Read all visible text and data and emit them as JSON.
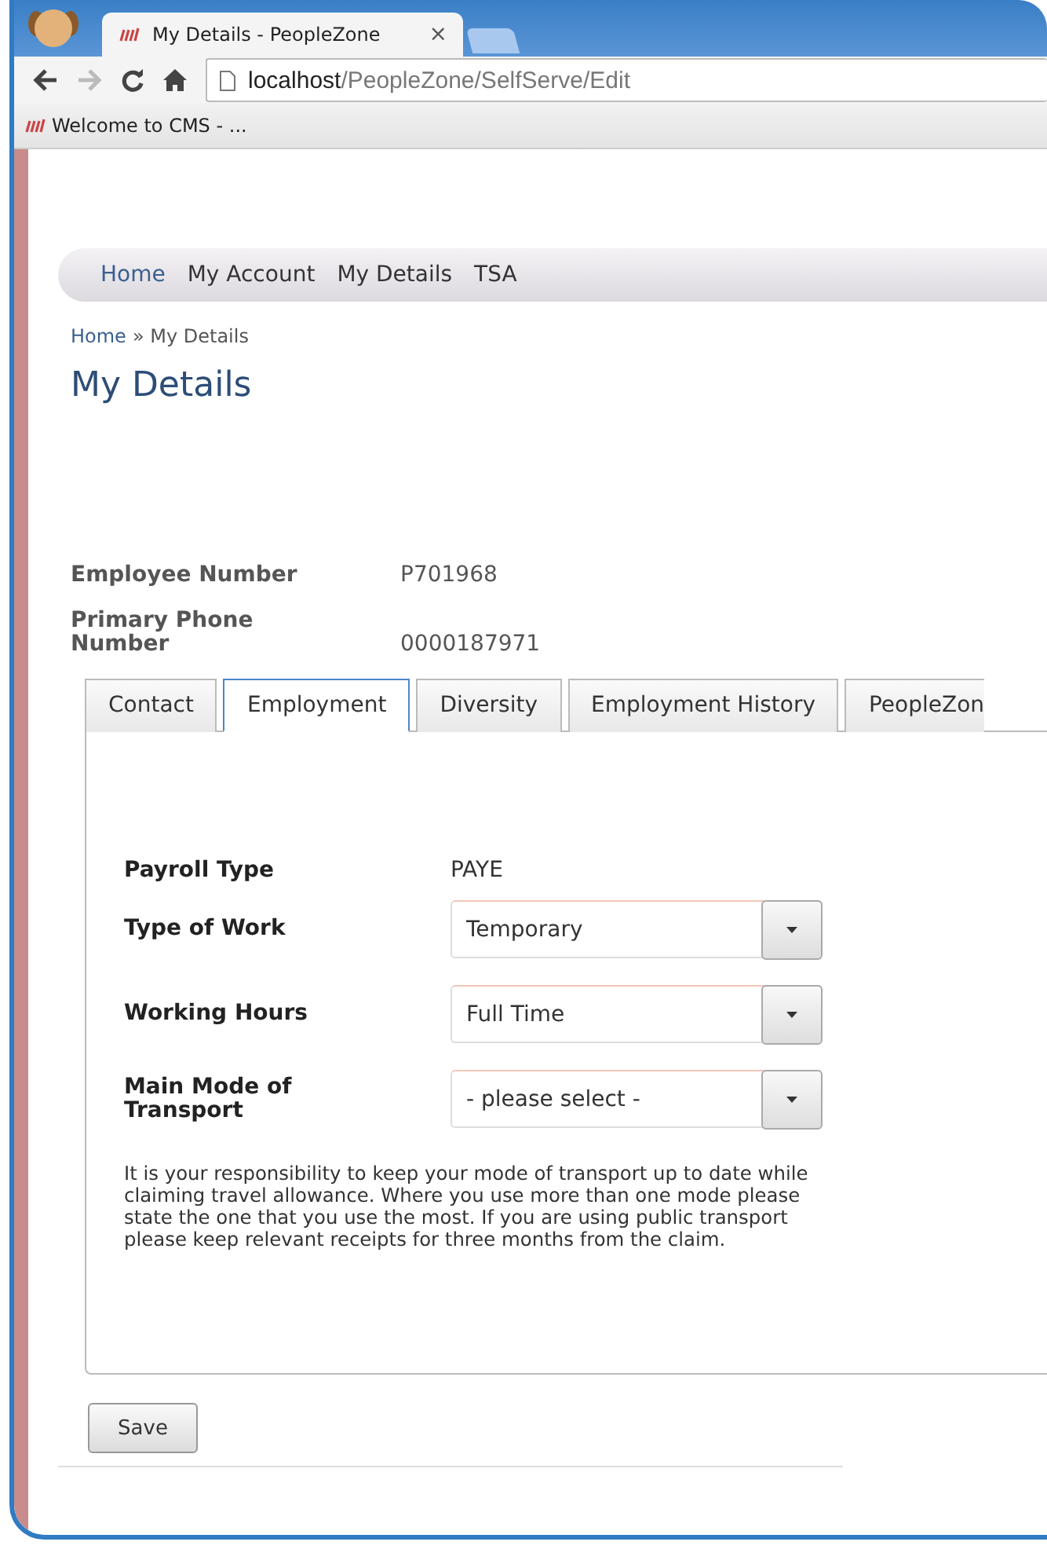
{
  "browser": {
    "tab_title": "My Details - PeopleZone",
    "tab_close": "×",
    "address": {
      "host": "localhost",
      "path": "/PeopleZone/SelfServe/Edit"
    },
    "bookmarks": [
      "Welcome to CMS - ..."
    ]
  },
  "nav": [
    {
      "label": "Home",
      "selected": true
    },
    {
      "label": "My Account",
      "selected": false
    },
    {
      "label": "My Details",
      "selected": false
    },
    {
      "label": "TSA",
      "selected": false
    }
  ],
  "breadcrumb": {
    "link": "Home",
    "separator": "»",
    "current": "My Details"
  },
  "title": "My Details",
  "summary": [
    {
      "label": "Employee Number",
      "value": "P701968"
    },
    {
      "label": "Primary Phone Number",
      "value": "0000187971"
    }
  ],
  "tabs": [
    {
      "label": "Contact",
      "selected": false
    },
    {
      "label": "Employment",
      "selected": true
    },
    {
      "label": "Diversity",
      "selected": false
    },
    {
      "label": "Employment History",
      "selected": false
    },
    {
      "label": "PeopleZon",
      "selected": false
    }
  ],
  "fields": [
    {
      "kind": "text",
      "label": "Payroll Type",
      "value": "PAYE"
    },
    {
      "kind": "select",
      "label": "Type of Work",
      "value": "Temporary"
    },
    {
      "kind": "select",
      "label": "Working Hours",
      "value": "Full Time"
    },
    {
      "kind": "select",
      "label": "Main Mode of Transport",
      "value": "- please select -"
    }
  ],
  "note": "It is your responsibility to keep your mode of transport up to date while claiming travel allowance. Where you use more than one mode please state the one that you use the most. If you are using public transport please keep relevant receipts for three months from the claim.",
  "buttons": [
    "Save"
  ]
}
